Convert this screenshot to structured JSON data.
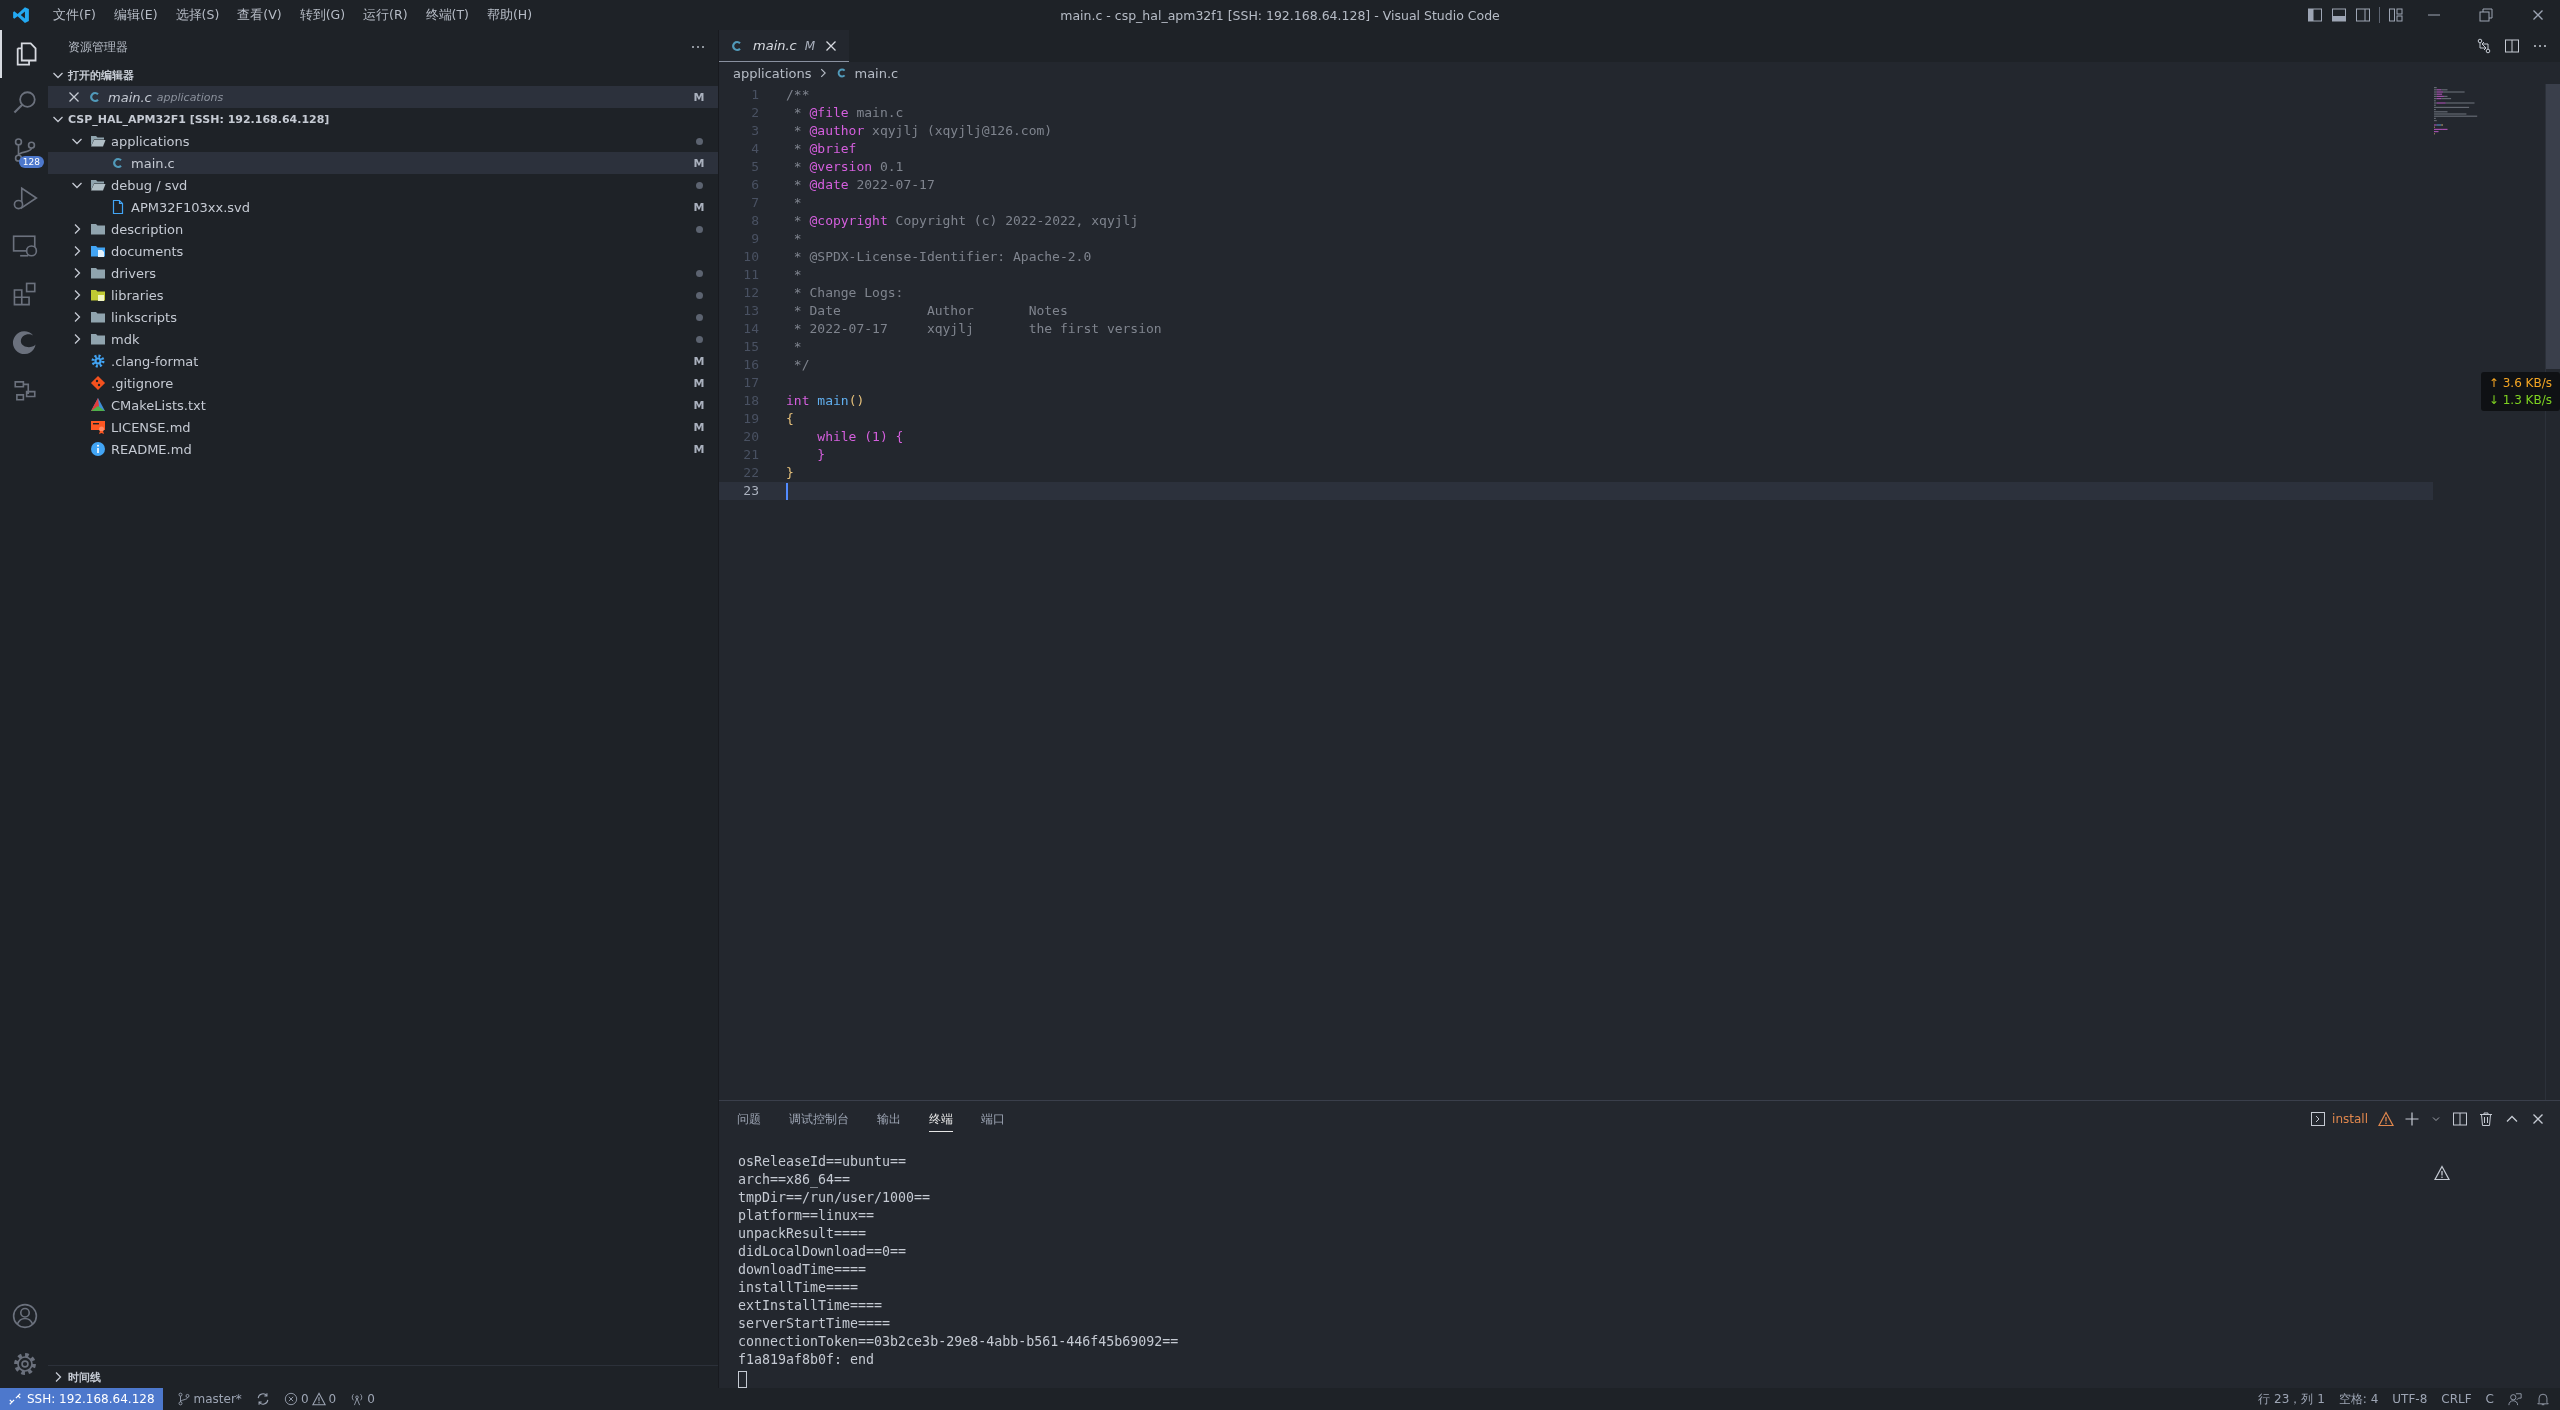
{
  "title_bar": {
    "menu": [
      "文件(F)",
      "编辑(E)",
      "选择(S)",
      "查看(V)",
      "转到(G)",
      "运行(R)",
      "终端(T)",
      "帮助(H)"
    ],
    "title": "main.c - csp_hal_apm32f1 [SSH: 192.168.64.128] - Visual Studio Code"
  },
  "activity_bar": {
    "items": [
      {
        "kind": "explorer",
        "selected": true
      },
      {
        "kind": "search",
        "selected": false
      },
      {
        "kind": "scm",
        "selected": false,
        "badge": "128"
      },
      {
        "kind": "run",
        "selected": false
      },
      {
        "kind": "remote",
        "selected": false
      },
      {
        "kind": "extensions",
        "selected": false
      },
      {
        "kind": "edge",
        "selected": false
      },
      {
        "kind": "nodes",
        "selected": false
      }
    ],
    "bottom": [
      {
        "kind": "account"
      },
      {
        "kind": "settings"
      }
    ]
  },
  "explorer": {
    "title": "资源管理器",
    "open_editors": {
      "title": "打开的编辑器",
      "expanded": true,
      "items": [
        {
          "name": "main.c",
          "detail": "applications",
          "kind": "c-file",
          "badge": "M",
          "selected": true
        }
      ]
    },
    "workspace": {
      "title": "CSP_HAL_APM32F1 [SSH: 192.168.64.128]",
      "expanded": true,
      "items": [
        {
          "name": "applications",
          "kind": "folder",
          "expanded": true,
          "dot": true,
          "selected": false,
          "children": [
            {
              "name": "main.c",
              "kind": "c-file",
              "badge": "M",
              "dot": false,
              "selected": true
            }
          ]
        },
        {
          "name": "debug / svd",
          "kind": "folder",
          "expanded": true,
          "dot": true,
          "selected": false,
          "children": [
            {
              "name": "APM32F103xx.svd",
              "kind": "doc",
              "badge": "M",
              "dot": false,
              "selected": false
            }
          ]
        },
        {
          "name": "description",
          "kind": "folder",
          "expanded": false,
          "dot": true,
          "selected": false
        },
        {
          "name": "documents",
          "kind": "folder-docs",
          "expanded": false,
          "dot": false,
          "selected": false
        },
        {
          "name": "drivers",
          "kind": "folder",
          "expanded": false,
          "dot": true,
          "selected": false
        },
        {
          "name": "libraries",
          "kind": "folder-lib",
          "expanded": false,
          "dot": true,
          "selected": false
        },
        {
          "name": "linkscripts",
          "kind": "folder",
          "expanded": false,
          "dot": true,
          "selected": false
        },
        {
          "name": "mdk",
          "kind": "folder",
          "expanded": false,
          "dot": true,
          "selected": false
        },
        {
          "name": ".clang-format",
          "kind": "gear",
          "badge": "M",
          "dot": false,
          "selected": false
        },
        {
          "name": ".gitignore",
          "kind": "git",
          "badge": "M",
          "dot": false,
          "selected": false
        },
        {
          "name": "CMakeLists.txt",
          "kind": "cmake",
          "badge": "M",
          "dot": false,
          "selected": false
        },
        {
          "name": "LICENSE.md",
          "kind": "license",
          "badge": "M",
          "dot": false,
          "selected": false
        },
        {
          "name": "README.md",
          "kind": "info",
          "badge": "M",
          "dot": false,
          "selected": false
        }
      ]
    },
    "timeline": {
      "title": "时间线",
      "expanded": false
    }
  },
  "editor": {
    "tabs": [
      {
        "name": "main.c",
        "badge": "M",
        "selected": true
      }
    ],
    "breadcrumb": [
      "applications",
      "main.c"
    ],
    "lines": [
      {
        "number": "1",
        "current": false,
        "tokens": [
          {
            "text": "/**",
            "kind": "comment"
          }
        ]
      },
      {
        "number": "2",
        "current": false,
        "tokens": [
          {
            "text": " * ",
            "kind": "comment"
          },
          {
            "text": "@file",
            "kind": "doctag"
          },
          {
            "text": " main.c",
            "kind": "comment"
          }
        ]
      },
      {
        "number": "3",
        "current": false,
        "tokens": [
          {
            "text": " * ",
            "kind": "comment"
          },
          {
            "text": "@author",
            "kind": "doctag"
          },
          {
            "text": " xqyjlj (xqyjlj@126.com)",
            "kind": "comment"
          }
        ]
      },
      {
        "number": "4",
        "current": false,
        "tokens": [
          {
            "text": " * ",
            "kind": "comment"
          },
          {
            "text": "@brief",
            "kind": "doctag"
          }
        ]
      },
      {
        "number": "5",
        "current": false,
        "tokens": [
          {
            "text": " * ",
            "kind": "comment"
          },
          {
            "text": "@version",
            "kind": "doctag"
          },
          {
            "text": " 0.1",
            "kind": "comment"
          }
        ]
      },
      {
        "number": "6",
        "current": false,
        "tokens": [
          {
            "text": " * ",
            "kind": "comment"
          },
          {
            "text": "@date",
            "kind": "doctag"
          },
          {
            "text": " 2022-07-17",
            "kind": "comment"
          }
        ]
      },
      {
        "number": "7",
        "current": false,
        "tokens": [
          {
            "text": " *",
            "kind": "comment"
          }
        ]
      },
      {
        "number": "8",
        "current": false,
        "tokens": [
          {
            "text": " * ",
            "kind": "comment"
          },
          {
            "text": "@copyright",
            "kind": "doctag"
          },
          {
            "text": " Copyright (c) 2022-2022, xqyjlj",
            "kind": "comment"
          }
        ]
      },
      {
        "number": "9",
        "current": false,
        "tokens": [
          {
            "text": " *",
            "kind": "comment"
          }
        ]
      },
      {
        "number": "10",
        "current": false,
        "tokens": [
          {
            "text": " * @SPDX-License-Identifier: Apache-2.0",
            "kind": "comment"
          }
        ]
      },
      {
        "number": "11",
        "current": false,
        "tokens": [
          {
            "text": " *",
            "kind": "comment"
          }
        ]
      },
      {
        "number": "12",
        "current": false,
        "tokens": [
          {
            "text": " * Change Logs:",
            "kind": "comment"
          }
        ]
      },
      {
        "number": "13",
        "current": false,
        "tokens": [
          {
            "text": " * Date           Author       Notes",
            "kind": "comment"
          }
        ]
      },
      {
        "number": "14",
        "current": false,
        "tokens": [
          {
            "text": " * 2022-07-17     xqyjlj       the first version",
            "kind": "comment"
          }
        ]
      },
      {
        "number": "15",
        "current": false,
        "tokens": [
          {
            "text": " *",
            "kind": "comment"
          }
        ]
      },
      {
        "number": "16",
        "current": false,
        "tokens": [
          {
            "text": " */",
            "kind": "comment"
          }
        ]
      },
      {
        "number": "17",
        "current": false
      },
      {
        "number": "18",
        "current": false,
        "tokens": [
          {
            "text": "int",
            "kind": "keyword"
          },
          {
            "text": " main",
            "kind": "function"
          },
          {
            "text": "()",
            "kind": "bracket1"
          }
        ]
      },
      {
        "number": "19",
        "current": false,
        "tokens": [
          {
            "text": "{",
            "kind": "bracket1"
          }
        ]
      },
      {
        "number": "20",
        "current": false,
        "tokens": [
          {
            "text": "    while",
            "kind": "keyword"
          },
          {
            "text": " (1) {",
            "kind": "bracket2"
          }
        ]
      },
      {
        "number": "21",
        "current": false,
        "tokens": [
          {
            "text": "    }",
            "kind": "bracket2"
          }
        ]
      },
      {
        "number": "22",
        "current": false,
        "tokens": [
          {
            "text": "}",
            "kind": "bracket1"
          }
        ]
      },
      {
        "number": "23",
        "current": true
      }
    ]
  },
  "network_overlay": {
    "upload": "↑ 3.6 KB/s",
    "download": "↓ 1.3 KB/s"
  },
  "panel": {
    "tabs": [
      {
        "label": "问题",
        "selected": false
      },
      {
        "label": "调试控制台",
        "selected": false
      },
      {
        "label": "输出",
        "selected": false
      },
      {
        "label": "终端",
        "selected": true
      },
      {
        "label": "端口",
        "selected": false
      }
    ],
    "terminal_name": "install",
    "terminal_lines": [
      "osReleaseId==ubuntu==",
      "arch==x86_64==",
      "tmpDir==/run/user/1000==",
      "platform==linux==",
      "unpackResult====",
      "didLocalDownload==0==",
      "downloadTime====",
      "installTime====",
      "extInstallTime====",
      "serverStartTime====",
      "connectionToken==03b2ce3b-29e8-4abb-b561-446f45b69092==",
      "f1a819af8b0f: end"
    ]
  },
  "status_bar": {
    "remote": "SSH: 192.168.64.128",
    "branch": "master*",
    "errors": "0",
    "warnings": "0",
    "ports": "0",
    "right": [
      "行 23，列 1",
      "空格: 4",
      "UTF-8",
      "CRLF",
      "C"
    ]
  }
}
